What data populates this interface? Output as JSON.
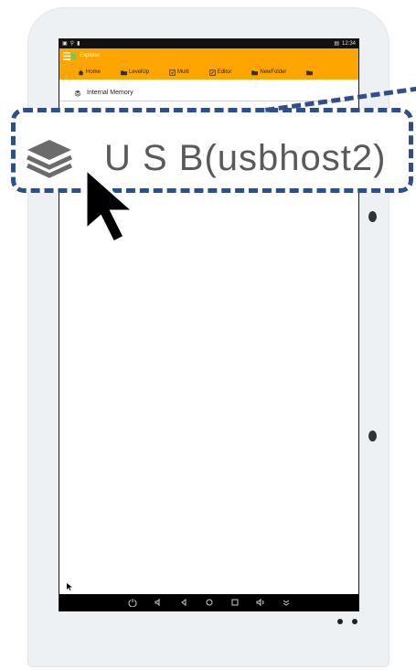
{
  "statusbar": {
    "left_icons": [
      "image-icon",
      "signal-icon",
      "battery-mini-icon"
    ],
    "time": "12:34"
  },
  "app": {
    "title": "Explorer"
  },
  "toolbar": {
    "items": [
      {
        "label": "Home",
        "icon": "home-icon"
      },
      {
        "label": "LevelUp",
        "icon": "folder-up-icon"
      },
      {
        "label": "Multi",
        "icon": "multi-select-icon"
      },
      {
        "label": "Editor",
        "icon": "edit-icon"
      },
      {
        "label": "NewFolder",
        "icon": "new-folder-icon"
      }
    ]
  },
  "storage_list": {
    "items": [
      {
        "label": "Internal Memory",
        "icon": "layers-icon"
      }
    ]
  },
  "zoom_callout": {
    "label": "U S B(usbhost2)",
    "icon": "layers-icon"
  },
  "navbar": {
    "icons": [
      "power-icon",
      "volume-down-icon",
      "back-icon",
      "home-circle-icon",
      "recents-icon",
      "volume-up-icon",
      "hide-bar-icon"
    ]
  },
  "colors": {
    "accent": "#ffa500",
    "callout_border": "#2f4f8c",
    "statusbar": "#111111",
    "navbar": "#000000"
  }
}
